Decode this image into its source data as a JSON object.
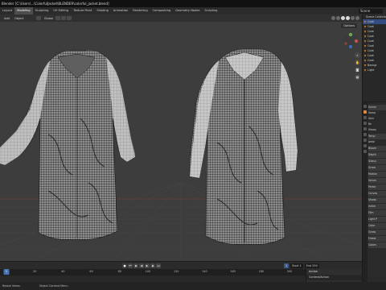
{
  "window": {
    "title": "Blender [C:\\Users\\...\\ColorfulJacket\\BLENDER\\colorful_jacket.blend]"
  },
  "menubar": {
    "items": [
      "Layout",
      "Modeling",
      "Sculpting",
      "UV Editing",
      "Texture Paint",
      "Shading",
      "Animation",
      "Rendering",
      "Compositing",
      "Geometry Nodes",
      "Scripting"
    ],
    "active": "Modeling",
    "scene": "Scene"
  },
  "toolheader": {
    "menus": [
      "Add",
      "Object"
    ],
    "orientation": "Global",
    "options": "Options"
  },
  "outliner": {
    "rows": [
      {
        "label": "Scene Collection",
        "selected": false
      },
      {
        "label": "Coat",
        "selected": true
      },
      {
        "label": "Coat",
        "selected": false
      },
      {
        "label": "Coat",
        "selected": false
      },
      {
        "label": "Coat",
        "selected": false
      },
      {
        "label": "Coat",
        "selected": false
      },
      {
        "label": "Coat",
        "selected": false
      },
      {
        "label": "Coat",
        "selected": false
      },
      {
        "label": "Coat",
        "selected": false
      },
      {
        "label": "Coat",
        "selected": false
      },
      {
        "label": "Backgr",
        "selected": false
      },
      {
        "label": "Light",
        "selected": false
      }
    ]
  },
  "properties": {
    "rows": [
      {
        "label": "Scene",
        "header": true
      },
      {
        "label": "Samp",
        "header": false
      },
      {
        "label": "Volu",
        "header": false
      },
      {
        "label": "Re",
        "header": false
      },
      {
        "label": "Viewp",
        "header": false
      },
      {
        "label": "Temp",
        "header": true
      },
      {
        "label": "Ambi",
        "header": false
      },
      {
        "label": "Bloom",
        "header": true
      },
      {
        "label": "Depth",
        "header": true
      },
      {
        "label": "Subsu",
        "header": true
      },
      {
        "label": "Scree",
        "header": true
      },
      {
        "label": "Motion",
        "header": true
      },
      {
        "label": "Volum",
        "header": true
      },
      {
        "label": "Perfor",
        "header": true
      },
      {
        "label": "Curves",
        "header": true
      },
      {
        "label": "Shado",
        "header": true
      },
      {
        "label": "Indire",
        "header": true
      },
      {
        "label": "Film",
        "header": true
      },
      {
        "label": "Light P",
        "header": true
      },
      {
        "label": "Color",
        "header": true
      },
      {
        "label": "Greas",
        "header": true
      },
      {
        "label": "Freest",
        "header": true
      },
      {
        "label": "Colors",
        "header": true
      }
    ]
  },
  "timeline": {
    "current_frame": "1",
    "start_label": "Start",
    "start": "1",
    "end_label": "End",
    "end": "250",
    "ruler": [
      "0",
      "20",
      "40",
      "60",
      "80",
      "100",
      "120",
      "140",
      "160",
      "180",
      "200",
      "220",
      "240"
    ],
    "playhead": "1"
  },
  "action_panel": {
    "title": "Action",
    "item": "Context/Action"
  },
  "statusbar": {
    "select": "Resize Views",
    "pan": "Object Context Menu"
  }
}
